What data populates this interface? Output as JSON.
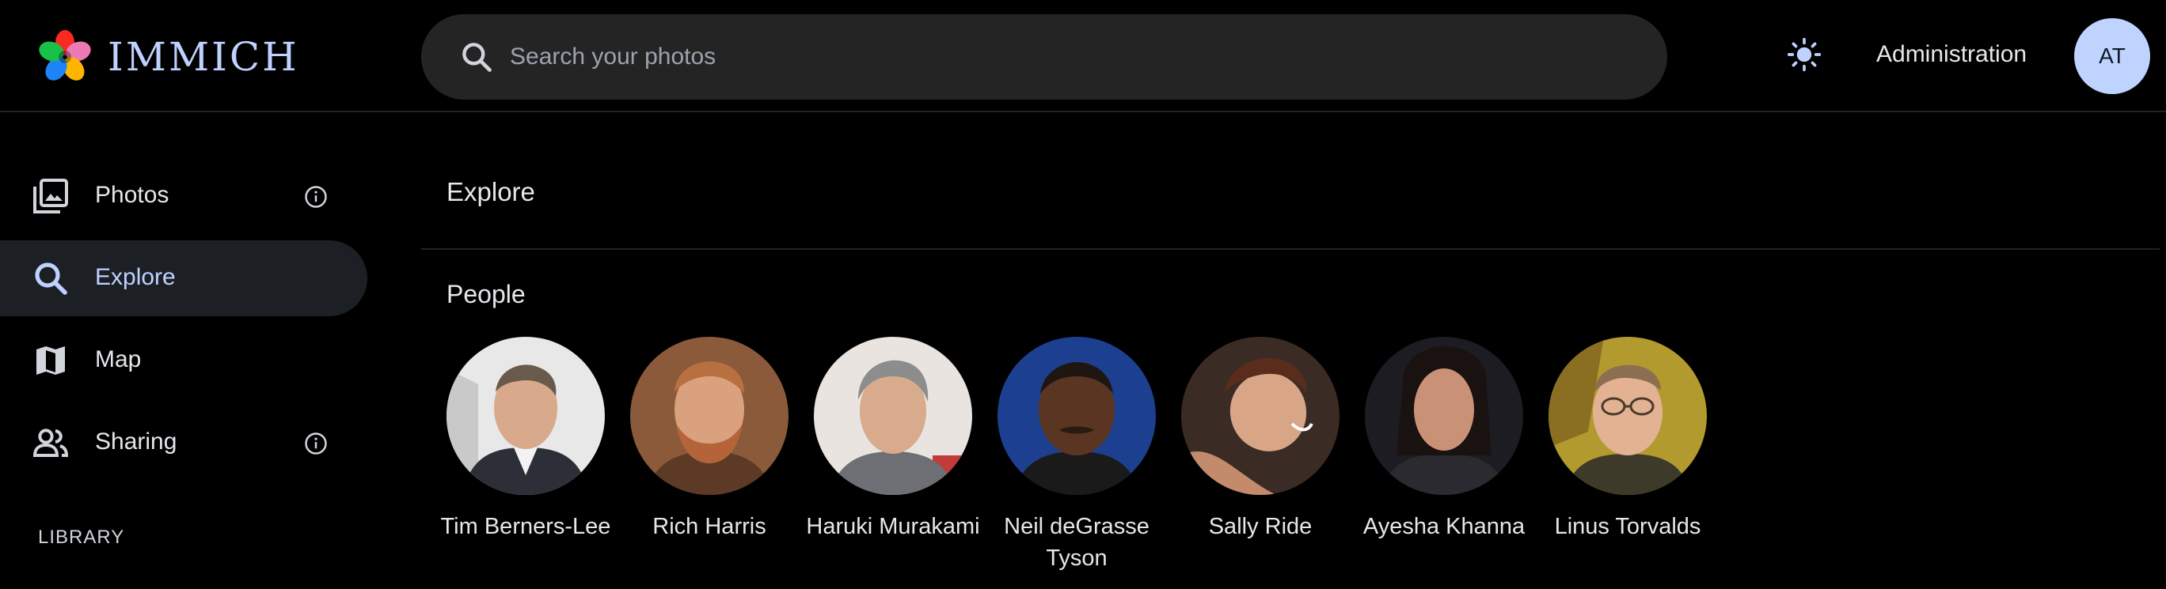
{
  "app": {
    "logo_text": "IMMICH"
  },
  "header": {
    "search_placeholder": "Search your photos",
    "administration_label": "Administration",
    "avatar_initials": "AT"
  },
  "sidebar": {
    "items": [
      {
        "label": "Photos",
        "icon": "photos-icon",
        "has_info": true,
        "active": false
      },
      {
        "label": "Explore",
        "icon": "search-icon",
        "has_info": false,
        "active": true
      },
      {
        "label": "Map",
        "icon": "map-icon",
        "has_info": false,
        "active": false
      },
      {
        "label": "Sharing",
        "icon": "sharing-icon",
        "has_info": true,
        "active": false
      }
    ],
    "library_label": "LIBRARY"
  },
  "main": {
    "title": "Explore",
    "people_title": "People",
    "people": [
      {
        "name": "Tim Berners-Lee"
      },
      {
        "name": "Rich Harris"
      },
      {
        "name": "Haruki Murakami"
      },
      {
        "name": "Neil deGrasse Tyson"
      },
      {
        "name": "Sally Ride"
      },
      {
        "name": "Ayesha Khanna"
      },
      {
        "name": "Linus Torvalds"
      }
    ]
  },
  "colors": {
    "background": "#000000",
    "accent": "#bfd2ff",
    "search_bg": "#242424",
    "active_nav_bg": "#1c1f24"
  }
}
